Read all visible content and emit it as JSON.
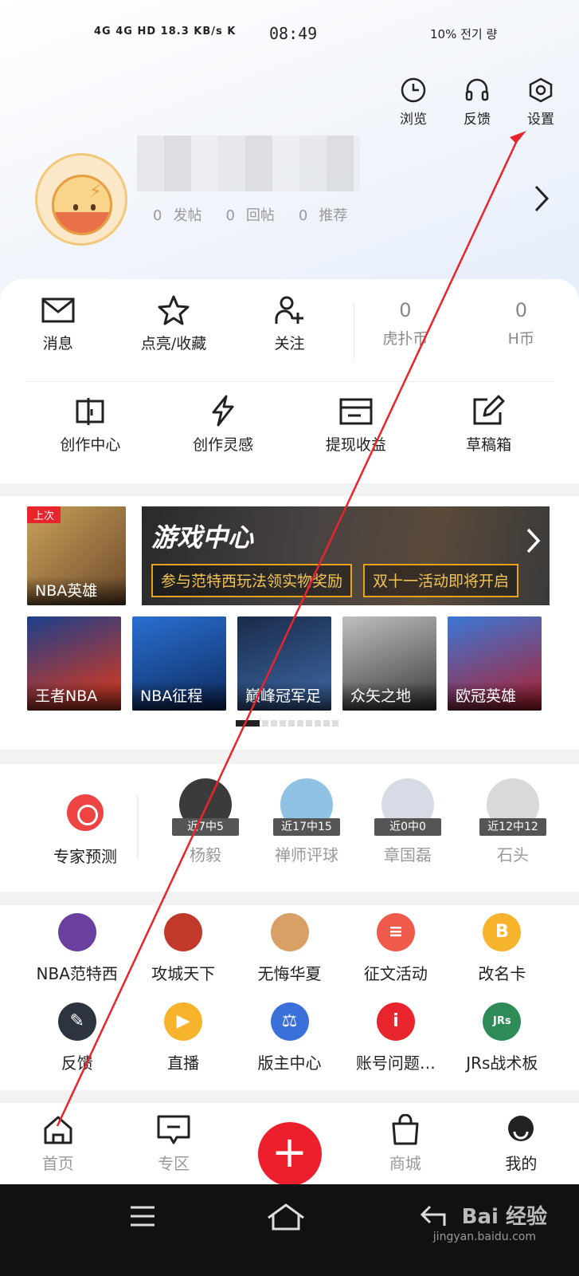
{
  "status_bar": {
    "signal": "4G 4G HD 18.3 KB/s K",
    "time": "08:49",
    "right": "10%  전기 량"
  },
  "header": {
    "icons": [
      {
        "label": "浏览",
        "icon": "clock-icon"
      },
      {
        "label": "反馈",
        "icon": "headset-icon"
      },
      {
        "label": "设置",
        "icon": "hexagon-gear-icon"
      }
    ],
    "stats": [
      {
        "count": "0",
        "label": "发帖"
      },
      {
        "count": "0",
        "label": "回帖"
      },
      {
        "count": "0",
        "label": "推荐"
      }
    ]
  },
  "quick_row": [
    {
      "label": "消息",
      "icon": "envelope-icon"
    },
    {
      "label": "点亮/收藏",
      "icon": "star-icon"
    },
    {
      "label": "关注",
      "icon": "add-user-icon"
    },
    {
      "num": "0",
      "label": "虎扑币"
    },
    {
      "num": "0",
      "label": "H币"
    }
  ],
  "creator_row": [
    {
      "label": "创作中心",
      "icon": "creator-center-icon"
    },
    {
      "label": "创作灵感",
      "icon": "lightning-icon"
    },
    {
      "label": "提现收益",
      "icon": "wallet-icon"
    },
    {
      "label": "草稿箱",
      "icon": "edit-icon"
    }
  ],
  "games": {
    "recent": {
      "tag": "上次",
      "label": "NBA英雄"
    },
    "banner": {
      "title": "游戏中心",
      "pill_1": "参与范特西玩法领实物奖励",
      "pill_2": "双十一活动即将开启"
    },
    "tiles": [
      "王者NBA",
      "NBA征程",
      "巅峰冠军足",
      "众矢之地",
      "欧冠英雄"
    ]
  },
  "experts": {
    "label": "专家预测",
    "people": [
      {
        "badge": "近7中5",
        "name": "杨毅"
      },
      {
        "badge": "近17中15",
        "name": "禅师评球"
      },
      {
        "badge": "近0中0",
        "name": "章国磊"
      },
      {
        "badge": "近12中12",
        "name": "石头"
      }
    ]
  },
  "services": {
    "row1": [
      {
        "label": "NBA范特西",
        "icon": "nba-fantasy-icon",
        "color": "#6b3fa0"
      },
      {
        "label": "攻城天下",
        "icon": "warrior-icon",
        "color": "#c0392b"
      },
      {
        "label": "无悔华夏",
        "icon": "lady-icon",
        "color": "#d9a066"
      },
      {
        "label": "征文活动",
        "icon": "coins-icon",
        "color": "#f05a4a"
      },
      {
        "label": "改名卡",
        "icon": "rename-card-icon",
        "color": "#f7b32b"
      }
    ],
    "row2": [
      {
        "label": "反馈",
        "icon": "pen-icon",
        "color": "#2d3440"
      },
      {
        "label": "直播",
        "icon": "video-icon",
        "color": "#f7b32b"
      },
      {
        "label": "版主中心",
        "icon": "scale-icon",
        "color": "#3b6fd9"
      },
      {
        "label": "账号问题…",
        "icon": "info-icon",
        "color": "#e8242c"
      },
      {
        "label": "JRs战术板",
        "icon": "tactics-board-icon",
        "color": "#2e8b57"
      }
    ]
  },
  "tabbar": [
    {
      "label": "首页",
      "icon": "home-icon"
    },
    {
      "label": "专区",
      "icon": "chat-icon"
    },
    {
      "label": "",
      "icon": "plus-icon"
    },
    {
      "label": "商城",
      "icon": "shopping-bag-icon"
    },
    {
      "label": "我的",
      "icon": "profile-icon"
    }
  ],
  "watermark": {
    "text": "Bai 经验",
    "url": "jingyan.baidu.com"
  },
  "colors": {
    "accent": "#ee1f2c",
    "annotation_arrow": "#e8242c"
  }
}
